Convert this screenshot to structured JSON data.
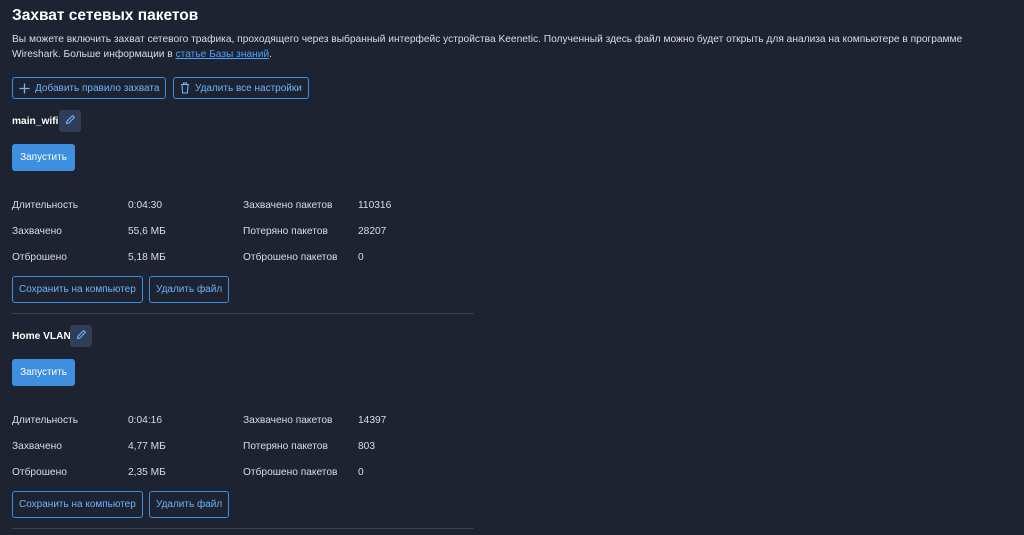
{
  "page": {
    "title": "Захват сетевых пакетов",
    "description_text": "Вы можете включить захват сетевого трафика, проходящего через выбранный интерфейс устройства Keenetic. Полученный здесь файл можно будет открыть для анализа на компьютере в программе Wireshark. Больше информации в ",
    "description_link": "статье Базы знаний",
    "description_end": "."
  },
  "toolbar": {
    "add_rule_label": "Добавить правило захвата",
    "delete_all_label": "Удалить все настройки"
  },
  "captures": [
    {
      "name": "main_wifi",
      "start_label": "Запустить",
      "stats": {
        "duration_label": "Длительность",
        "duration": "0:04:30",
        "captured_label": "Захвачено",
        "captured": "55,6 МБ",
        "dropped_label": "Отброшено",
        "dropped": "5,18 МБ",
        "packets_captured_label": "Захвачено пакетов",
        "packets_captured": "110316",
        "packets_lost_label": "Потеряно пакетов",
        "packets_lost": "28207",
        "packets_dropped_label": "Отброшено пакетов",
        "packets_dropped": "0"
      },
      "save_label": "Сохранить на компьютер",
      "delete_label": "Удалить файл"
    },
    {
      "name": "Home VLAN",
      "start_label": "Запустить",
      "stats": {
        "duration_label": "Длительность",
        "duration": "0:04:16",
        "captured_label": "Захвачено",
        "captured": "4,77 МБ",
        "dropped_label": "Отброшено",
        "dropped": "2,35 МБ",
        "packets_captured_label": "Захвачено пакетов",
        "packets_captured": "14397",
        "packets_lost_label": "Потеряно пакетов",
        "packets_lost": "803",
        "packets_dropped_label": "Отброшено пакетов",
        "packets_dropped": "0"
      },
      "save_label": "Сохранить на компьютер",
      "delete_label": "Удалить файл"
    }
  ],
  "icons": {
    "add": "plus-icon",
    "delete": "trash-icon",
    "edit": "pencil-icon"
  },
  "colors": {
    "background": "#1d2330",
    "accent": "#3e8fdf",
    "link": "#4da3ff"
  }
}
